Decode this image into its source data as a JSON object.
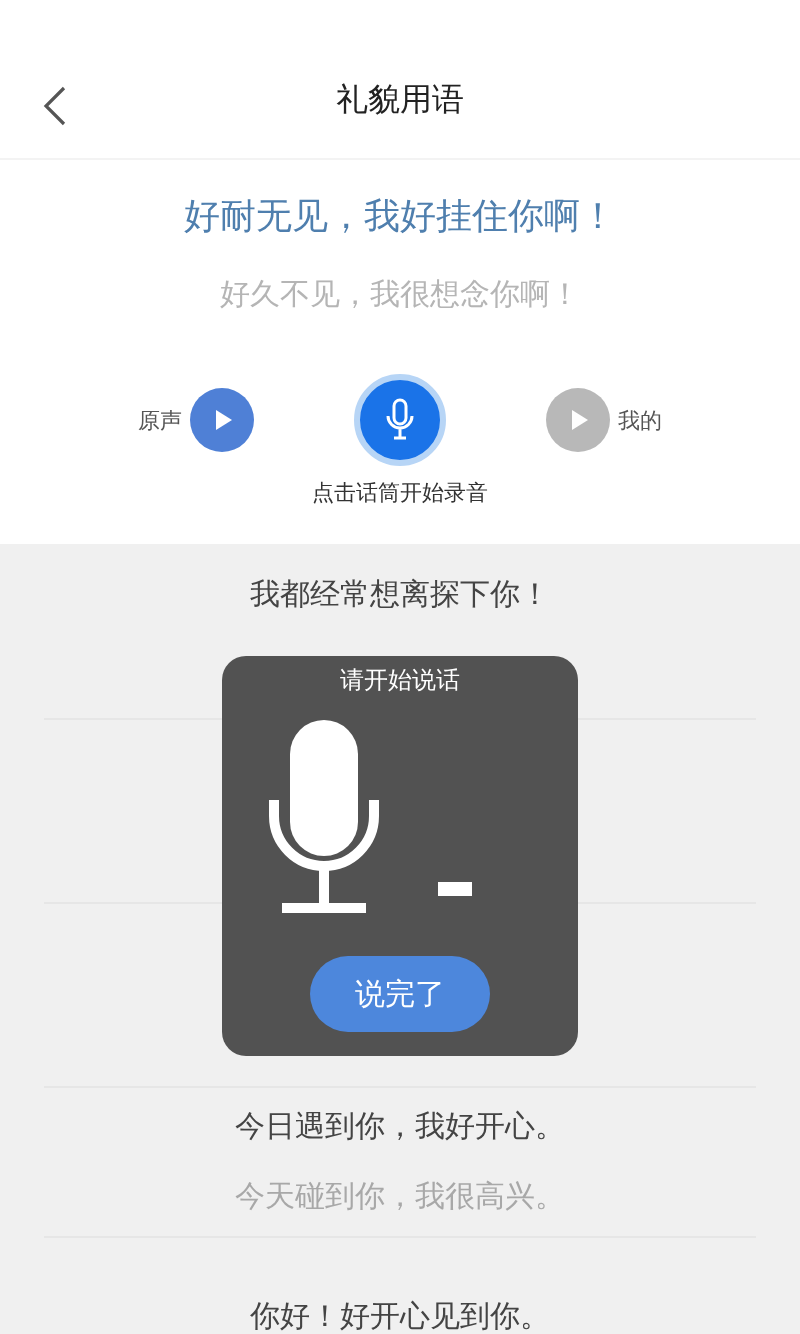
{
  "header": {
    "title": "礼貌用语"
  },
  "card": {
    "phrase": "好耐无见，我好挂住你啊！",
    "translation": "好久不见，我很想念你啊！",
    "players": [
      {
        "label": "原声",
        "enabled": true
      },
      {
        "label": "我的",
        "enabled": false
      }
    ],
    "hint": "点击话筒开始录音"
  },
  "list": [
    {
      "lines": [
        {
          "text": "我都经常想离探下你！",
          "kind": "primary"
        }
      ]
    },
    {
      "lines": [
        {
          "text": "今日遇到你，我好开心。",
          "kind": "primary"
        },
        {
          "text": "今天碰到你，我很高兴。",
          "kind": "secondary"
        }
      ]
    },
    {
      "lines": [
        {
          "text": "你好！好开心见到你。",
          "kind": "primary"
        }
      ]
    }
  ],
  "dialog": {
    "title": "请开始说话",
    "button": "说完了"
  }
}
